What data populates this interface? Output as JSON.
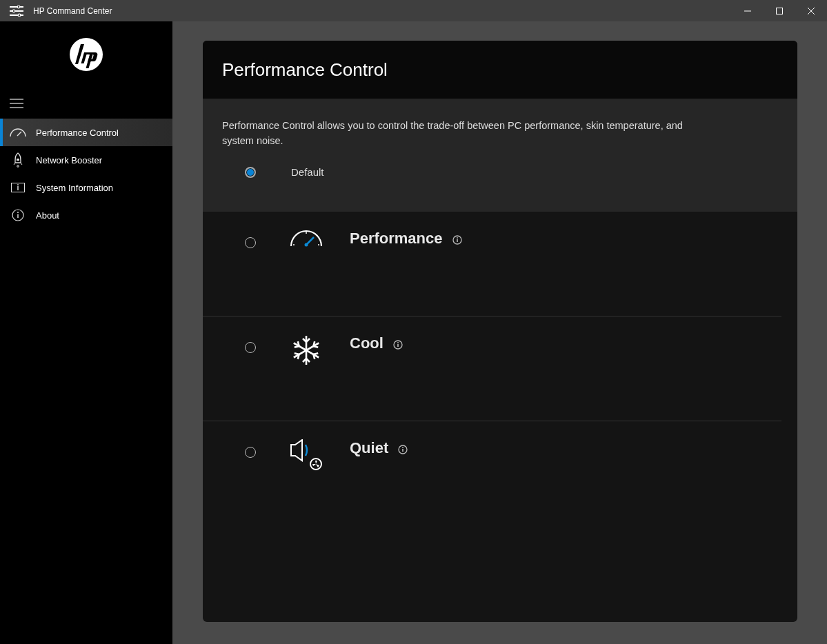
{
  "window": {
    "title": "HP Command Center"
  },
  "sidebar": {
    "items": [
      {
        "kind": "gauge",
        "label": "Performance Control",
        "selected": true
      },
      {
        "kind": "rocket",
        "label": "Network Booster",
        "selected": false
      },
      {
        "kind": "sysinfo",
        "label": "System Information",
        "selected": false
      },
      {
        "kind": "about",
        "label": "About",
        "selected": false
      }
    ]
  },
  "panel": {
    "title": "Performance Control",
    "description": "Performance Control allows you to control the trade-off between PC performance, skin temperature, and system noise.",
    "default_option": {
      "label": "Default",
      "selected": true
    },
    "modes": [
      {
        "kind": "performance",
        "label": "Performance",
        "selected": false
      },
      {
        "kind": "cool",
        "label": "Cool",
        "selected": false
      },
      {
        "kind": "quiet",
        "label": "Quiet",
        "selected": false
      }
    ]
  }
}
